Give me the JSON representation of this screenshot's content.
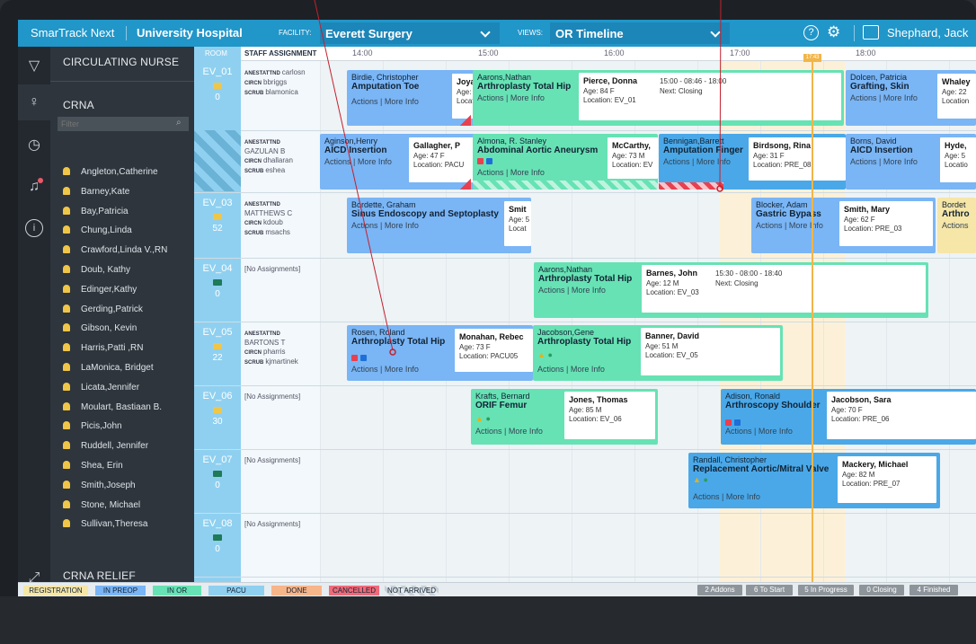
{
  "topbar": {
    "app": "SmarTrack Next",
    "hospital": "University Hospital",
    "facility_label": "FACILITY:",
    "facility_value": "Everett Surgery",
    "views_label": "VIEWS:",
    "views_value": "OR Timeline",
    "user": "Shephard, Jack"
  },
  "staff_panel": {
    "sections": [
      "CIRCULATING NURSE",
      "CRNA",
      "CRNA RELIEF"
    ],
    "filter_placeholder": "Filter",
    "nurses": [
      "Angleton,Catherine",
      "Barney,Kate",
      "Bay,Patricia",
      "Chung,Linda",
      "Crawford,Linda V.,RN",
      "Doub, Kathy",
      "Edinger,Kathy",
      "Gerding,Patrick",
      "Gibson, Kevin",
      "Harris,Patti ,RN",
      "LaMonica, Bridget",
      "Licata,Jennifer",
      "Moulart, Bastiaan B.",
      "Picis,John",
      "Ruddell, Jennifer",
      "Shea, Erin",
      "Smith,Joseph",
      "Stone, Michael",
      "Sullivan,Theresa"
    ]
  },
  "grid": {
    "room_header": "ROOM",
    "assign_header": "STAFF ASSIGNMENT",
    "times": [
      "14:00",
      "15:00",
      "16:00",
      "17:00",
      "18:00"
    ],
    "now": "17:43"
  },
  "rooms": [
    {
      "id": "EV_01",
      "count": "0",
      "assign": [
        [
          "ANESTATTND",
          "carlosn"
        ],
        [
          "CIRCN",
          "bbriggs"
        ],
        [
          "SCRUB",
          "blamonica"
        ]
      ]
    },
    {
      "id": "EV_02",
      "count": "8",
      "assign": [
        [
          "ANESTATTND",
          ""
        ],
        [
          "",
          "GAZULAN B"
        ],
        [
          "CIRCN",
          "dhallaran"
        ],
        [
          "SCRUB",
          "eshea"
        ]
      ]
    },
    {
      "id": "EV_03",
      "count": "52",
      "assign": [
        [
          "ANESTATTND",
          ""
        ],
        [
          "",
          "MATTHEWS C"
        ],
        [
          "CIRCN",
          "kdoub"
        ],
        [
          "SCRUB",
          "msachs"
        ]
      ]
    },
    {
      "id": "EV_04",
      "count": "0",
      "assign_text": "[No Assignments]"
    },
    {
      "id": "EV_05",
      "count": "22",
      "assign": [
        [
          "ANESTATTND",
          ""
        ],
        [
          "",
          "BARTONS T"
        ],
        [
          "CIRCN",
          "pharris"
        ],
        [
          "SCRUB",
          "kjmartinek"
        ]
      ]
    },
    {
      "id": "EV_06",
      "count": "30",
      "assign_text": "[No Assignments]"
    },
    {
      "id": "EV_07",
      "count": "0",
      "assign_text": "[No Assignments]"
    },
    {
      "id": "EV_08",
      "count": "0",
      "assign_text": "[No Assignments]"
    }
  ],
  "cards": {
    "c1": {
      "patient": "Birdie, Christopher",
      "procedure": "Amputation Toe",
      "actions": "Actions | More Info"
    },
    "c1p": {
      "name": "Joyal,",
      "age": "Age: 3",
      "loc": "Locatio"
    },
    "c2": {
      "patient": "Aarons,Nathan",
      "procedure": "Arthroplasty Total Hip",
      "actions": "Actions | More Info"
    },
    "c2p": {
      "name": "Pierce, Donna",
      "age": "Age: 84 F",
      "loc": "Location: EV_01",
      "time": "15:00 - 08:46 - 18:00",
      "next": "Next: Closing"
    },
    "c3": {
      "patient": "Dolcen, Patricia",
      "procedure": "Grafting, Skin",
      "actions": "Actions | More Info"
    },
    "c3p": {
      "name": "Whaley",
      "age": "Age: 22",
      "loc": "Location"
    },
    "c4": {
      "patient": "Aginson,Henry",
      "procedure": "AICD Insertion",
      "actions": "Actions | More Info"
    },
    "c4p": {
      "name": "Gallagher, P",
      "age": "Age: 47 F",
      "loc": "Location: PACU"
    },
    "c5": {
      "patient": "Almona, R. Stanley",
      "procedure": "Abdominal Aortic Aneurysm",
      "actions": "Actions | More Info"
    },
    "c5p": {
      "name": "McCarthy,",
      "age": "Age: 73 M",
      "loc": "Location: EV"
    },
    "c6": {
      "patient": "Bennigan,Barrett",
      "procedure": "Amputation Finger",
      "actions": "Actions | More Info"
    },
    "c6p": {
      "name": "Birdsong, Rina",
      "age": "Age: 31 F",
      "loc": "Location: PRE_08"
    },
    "c7": {
      "patient": "Borns, David",
      "procedure": "AICD Insertion",
      "actions": "Actions | More Info"
    },
    "c7p": {
      "name": "Hyde,",
      "age": "Age: 5",
      "loc": "Locatio"
    },
    "c8": {
      "patient": "Bordette, Graham",
      "procedure": "Sinus Endoscopy and Septoplasty",
      "actions": "Actions | More Info"
    },
    "c8p": {
      "name": "Smit",
      "age": "Age: 5",
      "loc": "Locat"
    },
    "c9": {
      "patient": "Blocker, Adam",
      "procedure": "Gastric Bypass",
      "actions": "Actions | More Info"
    },
    "c9p": {
      "name": "Smith, Mary",
      "age": "Age: 62 F",
      "loc": "Location: PRE_03"
    },
    "c10": {
      "patient": "Bordet",
      "procedure": "Arthro",
      "actions": "Actions"
    },
    "c11": {
      "patient": "Aarons,Nathan",
      "procedure": "Arthroplasty Total Hip",
      "actions": "Actions | More Info"
    },
    "c11p": {
      "name": "Barnes, John",
      "age": "Age: 12 M",
      "loc": "Location: EV_03",
      "time": "15:30 - 08:00 - 18:40",
      "next": "Next: Closing"
    },
    "c12": {
      "patient": "Rosen, Roland",
      "procedure": "Arthroplasty Total Hip",
      "actions": "Actions | More Info"
    },
    "c12p": {
      "name": "Monahan, Rebec",
      "age": "Age: 73 F",
      "loc": "Location: PACU05"
    },
    "c13": {
      "patient": "Jacobson,Gene",
      "procedure": "Arthroplasty Total Hip",
      "actions": "Actions | More Info"
    },
    "c13p": {
      "name": "Banner, David",
      "age": "Age: 51 M",
      "loc": "Location: EV_05"
    },
    "c14": {
      "patient": "Krafts, Bernard",
      "procedure": "ORIF Femur",
      "actions": "Actions | More Info"
    },
    "c14p": {
      "name": "Jones, Thomas",
      "age": "Age: 85 M",
      "loc": "Location: EV_06"
    },
    "c15": {
      "patient": "Adison, Ronald",
      "procedure": "Arthroscopy Shoulder",
      "actions": "Actions | More Info"
    },
    "c15p": {
      "name": "Jacobson, Sara",
      "age": "Age: 70 F",
      "loc": "Location: PRE_06"
    },
    "c16": {
      "patient": "Randall, Christopher",
      "procedure": "Replacement Aortic/Mitral Valve",
      "actions": "Actions | More Info"
    },
    "c16p": {
      "name": "Mackery, Michael",
      "age": "Age: 82 M",
      "loc": "Location: PRE_07"
    }
  },
  "legend": {
    "items": [
      "REGISTRATION",
      "IN PREOP",
      "IN OR",
      "PACU",
      "DONE",
      "CANCELLED",
      "NOT ARRIVED"
    ],
    "colors": [
      "#f6e6a8",
      "#7ab5f5",
      "#67e2b4",
      "#8fd0f0",
      "#f7b58a",
      "#ee6b7a",
      "#e6ecef"
    ],
    "stats": [
      "2 Addons",
      "6 To Start",
      "5 In Progress",
      "0 Closing",
      "4 Finished"
    ]
  }
}
